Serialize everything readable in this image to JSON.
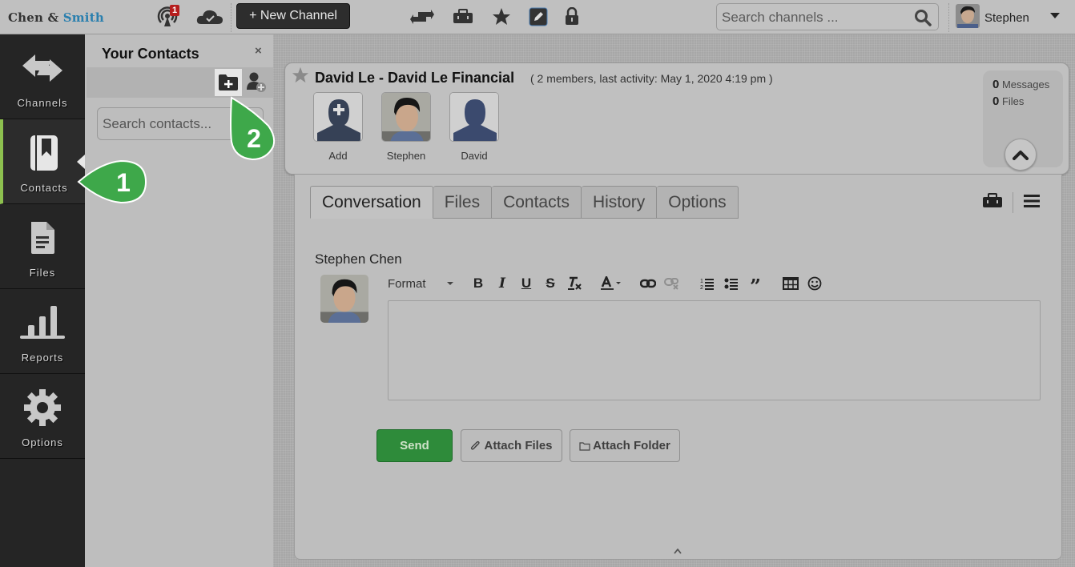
{
  "topbar": {
    "logo_part1": "Chen & ",
    "logo_part2": "Smith",
    "notification_count": "1",
    "new_channel_label": "+ New Channel",
    "icons": [
      "broadcast-icon",
      "cloud-check-icon",
      "transfer-icon",
      "toolbox-icon",
      "star-icon",
      "edit-icon",
      "lock-icon"
    ],
    "search_placeholder": "Search channels ...",
    "user_name": "Stephen"
  },
  "leftnav": {
    "items": [
      {
        "label": "Channels",
        "icon": "arrows-icon",
        "active": false
      },
      {
        "label": "Contacts",
        "icon": "contacts-book-icon",
        "active": true
      },
      {
        "label": "Files",
        "icon": "file-icon",
        "active": false
      },
      {
        "label": "Reports",
        "icon": "bar-chart-icon",
        "active": false
      },
      {
        "label": "Options",
        "icon": "gear-icon",
        "active": false
      }
    ]
  },
  "contacts_panel": {
    "title": "Your Contacts",
    "close_symbol": "×",
    "search_placeholder": "Search contacts..."
  },
  "channel": {
    "title": "David Le - David Le Financial",
    "meta": "( 2 members, last activity: May 1, 2020 4:19 pm )",
    "members": [
      {
        "label": "Add"
      },
      {
        "label": "Stephen"
      },
      {
        "label": "David"
      }
    ],
    "stats": {
      "messages_count": "0",
      "messages_label": "Messages",
      "files_count": "0",
      "files_label": "Files"
    }
  },
  "conversation": {
    "tabs": [
      {
        "label": "Conversation",
        "active": true
      },
      {
        "label": "Files",
        "active": false
      },
      {
        "label": "Contacts",
        "active": false
      },
      {
        "label": "History",
        "active": false
      },
      {
        "label": "Options",
        "active": false
      }
    ],
    "author": "Stephen Chen",
    "format_label": "Format",
    "editor_value": "",
    "send_label": "Send",
    "attach_files_label": "Attach Files",
    "attach_folder_label": "Attach Folder"
  },
  "callouts": {
    "step1": "1",
    "step2": "2"
  },
  "colors": {
    "accent_green": "#3ea84a",
    "send_green": "#2e8b3a",
    "brand_blue": "#2a7fae",
    "badge_red": "#b51d1d",
    "active_nav_bar": "#8dc04f"
  }
}
